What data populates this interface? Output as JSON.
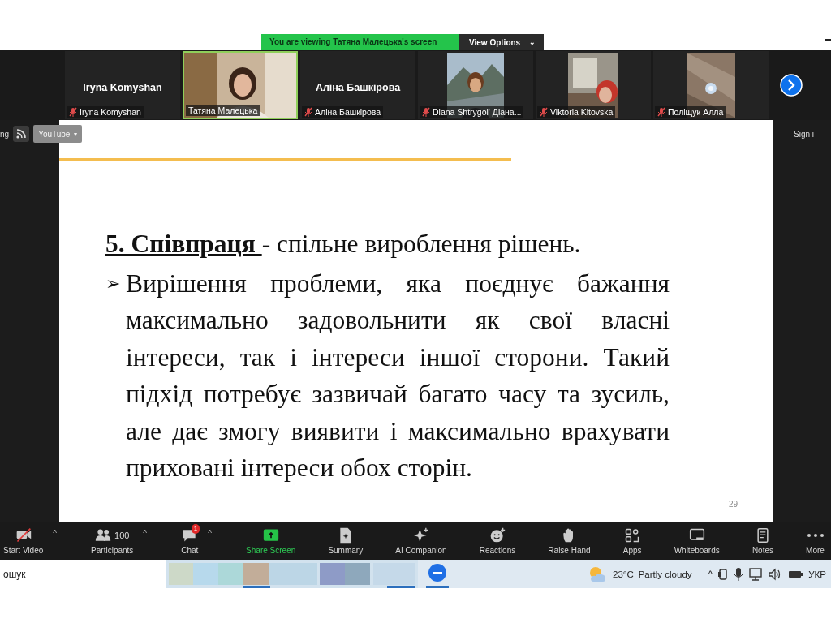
{
  "banner": {
    "viewing": "You are viewing Татяна Малецька's screen",
    "view_options": "View Options",
    "caret": "⌄"
  },
  "participants": [
    {
      "kind": "name",
      "big_name": "Iryna Komyshan",
      "label": "Iryna Komyshan",
      "muted": true,
      "speaking": false
    },
    {
      "kind": "video",
      "label": "Татяна Малецька",
      "muted": false,
      "speaking": true
    },
    {
      "kind": "name",
      "big_name": "Аліна Башкірова",
      "label": "Аліна Башкірова",
      "muted": true,
      "speaking": false
    },
    {
      "kind": "video",
      "label": "Diana Shtrygol' Діана...",
      "muted": true,
      "speaking": false
    },
    {
      "kind": "video",
      "label": "Viktoria Kitovska",
      "muted": true,
      "speaking": false
    },
    {
      "kind": "video",
      "label": "Поліщук Алла",
      "muted": true,
      "speaking": false
    }
  ],
  "browser_bar": {
    "left_text": "ng",
    "bookmark": "YouTube",
    "bookmark_caret": "▾",
    "right_text": "Sign i"
  },
  "slide": {
    "heading_term": "5. Співпраця ",
    "heading_rest": " - спільне вироблення рішень.",
    "bullet": "➢",
    "body": "Вирішення проблеми, яка поєднує бажання максимально задовольнити як свої власні інтереси, так і інтереси іншої сторони. Такий підхід потребує зазвичай багато часу та зусиль, але дає змогу виявити і максимально врахувати приховані інтереси обох сторін.",
    "page_number": "29"
  },
  "toolbar": [
    {
      "kind": "video",
      "label": "Start Video",
      "caret": "^",
      "off": true
    },
    {
      "kind": "participants",
      "label": "Participants",
      "count": "100",
      "caret": "^"
    },
    {
      "kind": "chat",
      "label": "Chat",
      "badge": "1",
      "caret": "^"
    },
    {
      "kind": "share",
      "label": "Share Screen"
    },
    {
      "kind": "summary",
      "label": "Summary"
    },
    {
      "kind": "ai",
      "label": "AI Companion"
    },
    {
      "kind": "reactions",
      "label": "Reactions"
    },
    {
      "kind": "hand",
      "label": "Raise Hand"
    },
    {
      "kind": "apps",
      "label": "Apps"
    },
    {
      "kind": "whiteboards",
      "label": "Whiteboards"
    },
    {
      "kind": "notes",
      "label": "Notes"
    },
    {
      "kind": "more",
      "label": "More"
    }
  ],
  "taskbar": {
    "search_value": "ошук",
    "temperature": "23°C",
    "weather": "Partly cloudy",
    "tray_caret": "^",
    "language": "УКР"
  }
}
